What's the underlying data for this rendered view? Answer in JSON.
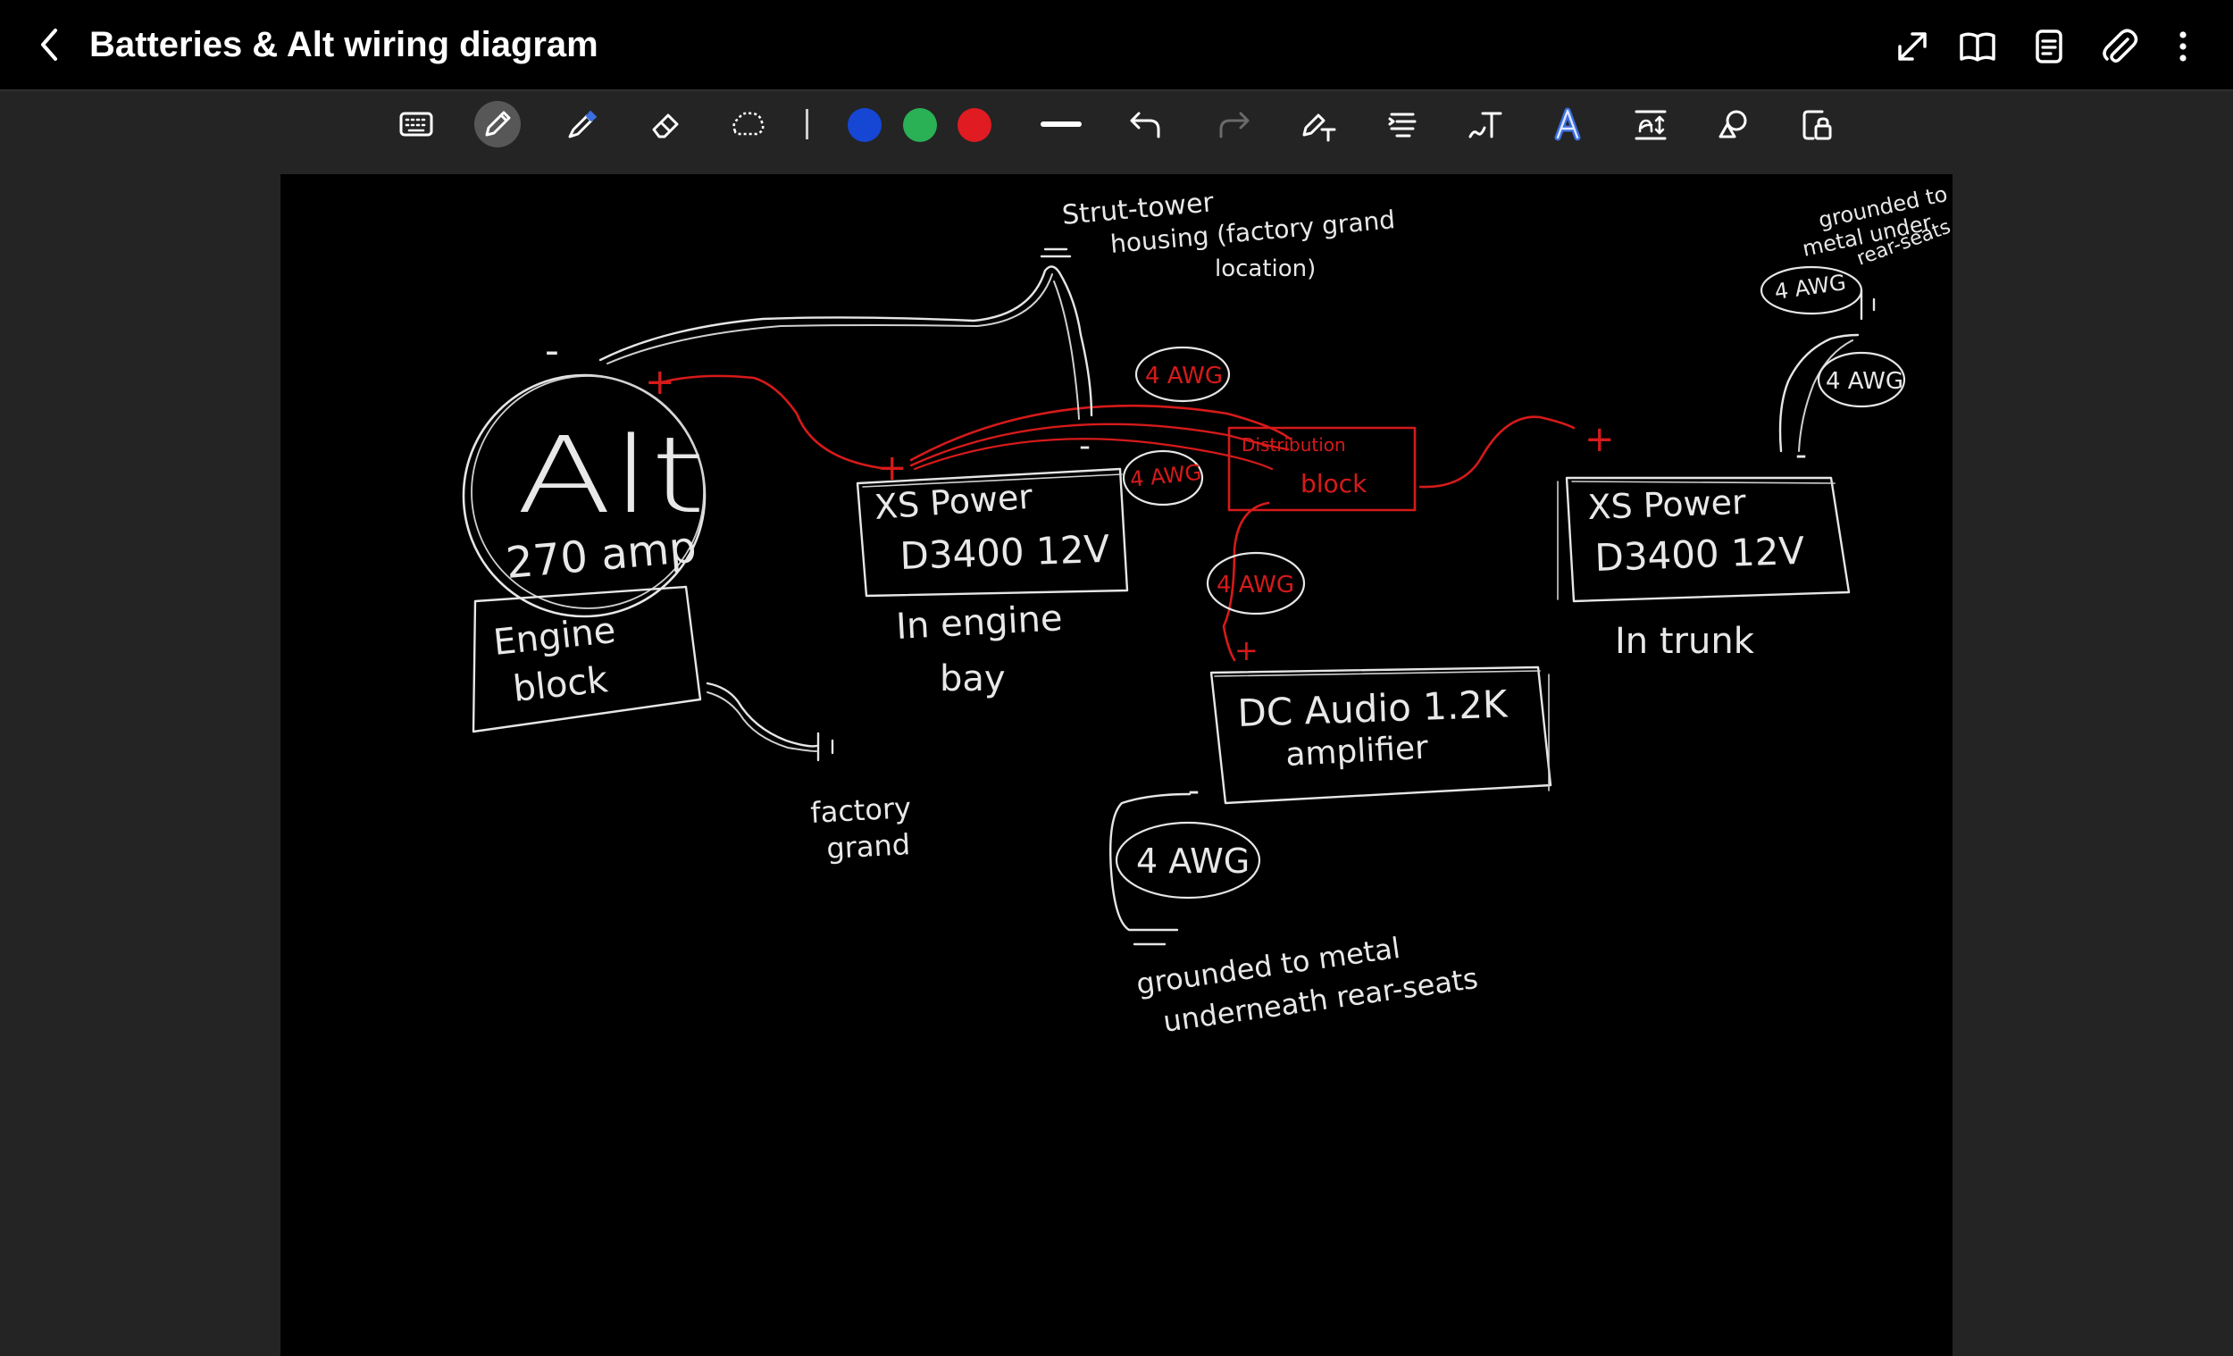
{
  "titlebar": {
    "title": "Batteries & Alt wiring diagram"
  },
  "toolbar": {
    "colors": [
      "#1546d4",
      "#2ab055",
      "#e01b22"
    ]
  },
  "diagram": {
    "alternator": {
      "label": "Alt",
      "rating": "270 amp"
    },
    "engine_block": {
      "line1": "Engine",
      "line2": "block"
    },
    "factory_ground": {
      "line1": "factory",
      "line2": "grand"
    },
    "strut_tower": {
      "line1": "Strut-tower",
      "line2": "housing (factory grand",
      "line3": "location)"
    },
    "front_battery": {
      "line1": "XS Power",
      "line2": "D3400  12V",
      "caption1": "In engine",
      "caption2": "bay"
    },
    "distribution": {
      "line1": "Distribution",
      "line2": "block"
    },
    "rear_battery": {
      "line1": "XS Power",
      "line2": "D3400  12V",
      "caption": "In trunk"
    },
    "amplifier": {
      "line1": "DC Audio  1.2K",
      "line2": "amplifier"
    },
    "trunk_ground": {
      "line1": "grounded to",
      "line2": "metal under",
      "line3": "rear-seats"
    },
    "amp_ground": {
      "line1": "grounded to metal",
      "line2": "underneath  rear-seats"
    },
    "wire_gauge": "4 AWG",
    "plus": "+",
    "minus": "-"
  }
}
